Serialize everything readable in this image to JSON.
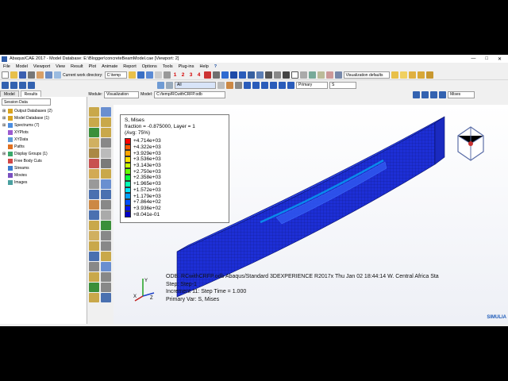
{
  "window": {
    "title": "Abaqus/CAE 2017 - Model Database: E:\\Blogger\\concreteBeamModel.cae [Viewport: 2]",
    "controls": [
      "—",
      "□",
      "✕"
    ]
  },
  "menu": [
    "File",
    "Model",
    "Viewport",
    "View",
    "Result",
    "Plot",
    "Animate",
    "Report",
    "Options",
    "Tools",
    "Plug-ins",
    "Help",
    "?"
  ],
  "toolbar": {
    "workdir_label": "Current work directory:",
    "workdir_value": "C:\\temp",
    "numbers": [
      "1",
      "2",
      "3",
      "4"
    ],
    "viz_defaults": "Visualization defaults",
    "filter_all": "All",
    "primary": "Primary",
    "var_s": "S",
    "var_mises": "Mises"
  },
  "context": {
    "module_label": "Module:",
    "module_value": "Visualization",
    "model_label": "Model:",
    "model_value": "C:/temp/RCwithCRFP.odb"
  },
  "left_panel": {
    "tabs": [
      "Model",
      "Results"
    ],
    "session_select": "Session Data",
    "tree": [
      {
        "label": "Output Databases (2)",
        "icon": "database-icon"
      },
      {
        "label": "Model Database (1)",
        "icon": "database-icon"
      },
      {
        "label": "Spectrums (7)",
        "icon": "spectrum-icon"
      },
      {
        "label": "XYPlots",
        "icon": "xyplot-icon"
      },
      {
        "label": "XYData",
        "icon": "xydata-icon"
      },
      {
        "label": "Paths",
        "icon": "path-icon"
      },
      {
        "label": "Display Groups (1)",
        "icon": "group-icon"
      },
      {
        "label": "Free Body Cuts",
        "icon": "cut-icon"
      },
      {
        "label": "Streams",
        "icon": "stream-icon"
      },
      {
        "label": "Movies",
        "icon": "movie-icon"
      },
      {
        "label": "Images",
        "icon": "image-icon"
      }
    ]
  },
  "legend": {
    "title": "S, Mises",
    "subtitle": "fraction = -0.875000, Layer = 1",
    "avg": "(Avg: 75%)",
    "values": [
      "+4.714e+03",
      "+4.322e+03",
      "+3.929e+03",
      "+3.536e+03",
      "+3.143e+03",
      "+2.750e+03",
      "+2.358e+03",
      "+1.965e+03",
      "+1.572e+03",
      "+1.179e+03",
      "+7.864e+02",
      "+3.936e+02",
      "+8.041e-01"
    ],
    "colors": [
      "#ff0000",
      "#ff5a00",
      "#ffa500",
      "#ffe000",
      "#c8ff00",
      "#64ff00",
      "#00ff3c",
      "#00ffb4",
      "#00e6ff",
      "#00a0ff",
      "#0050ff",
      "#0014f0",
      "#0000c8"
    ]
  },
  "viewport_info": {
    "line1": "ODB: RCwithCRFP.odb    Abaqus/Standard 3DEXPERIENCE R2017x    Thu Jan 02 18:44:14 W. Central Africa Sta",
    "line2": "Step: Step-1",
    "line3": "Increment     11: Step Time =      1.000",
    "line4": "Primary Var: S, Mises"
  },
  "brand": "SIMULIA",
  "axis": {
    "x": "X",
    "y": "Y",
    "z": "Z"
  }
}
